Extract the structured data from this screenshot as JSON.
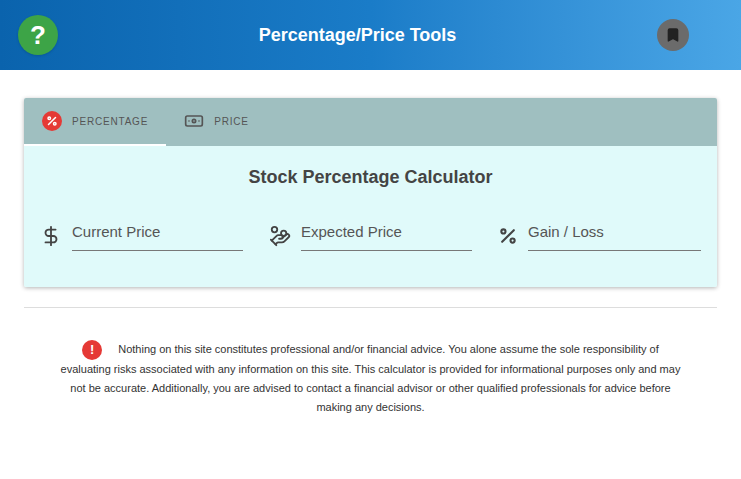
{
  "header": {
    "title": "Percentage/Price Tools",
    "help_label": "?"
  },
  "tabs": [
    {
      "label": "PERCENTAGE",
      "selected": true
    },
    {
      "label": "PRICE",
      "selected": false
    }
  ],
  "calculator": {
    "title": "Stock Percentage Calculator",
    "fields": [
      {
        "placeholder": "Current Price",
        "kind": "dollar"
      },
      {
        "placeholder": "Expected Price",
        "kind": "hand"
      },
      {
        "placeholder": "Gain / Loss",
        "kind": "percent"
      }
    ]
  },
  "disclaimer": {
    "icon_label": "!",
    "text": "Nothing on this site constitutes professional and/or financial advice. You alone assume the sole responsibility of evaluating risks associated with any information on this site. This calculator is provided for informational purposes only and may not be accurate. Additionally, you are advised to contact a financial advisor or other qualified professionals for advice before making any decisions."
  }
}
